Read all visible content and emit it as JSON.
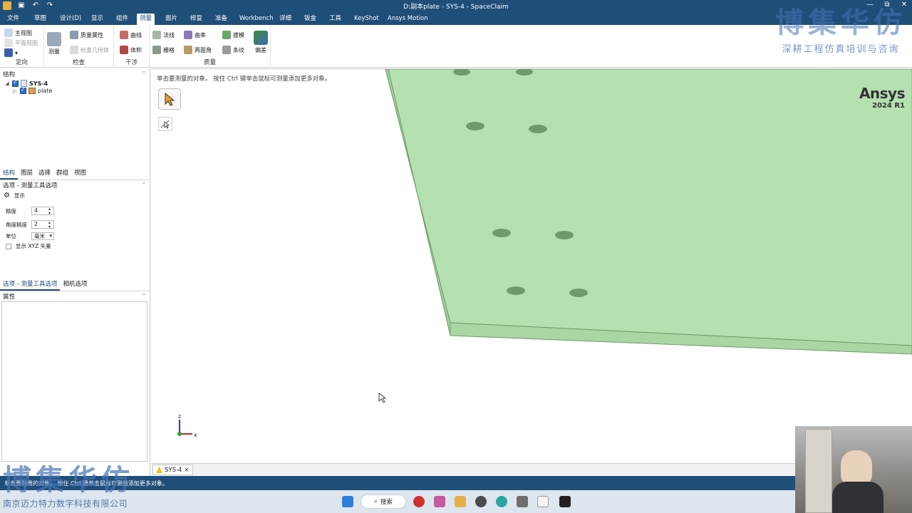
{
  "window": {
    "title": "D:副本plate - SYS-4 - SpaceClaim",
    "minimize": "—",
    "restore": "⧉",
    "close": "✕"
  },
  "menu_tabs": [
    "文件",
    "草图",
    "设计(D)",
    "显示",
    "组件",
    "测量",
    "面片",
    "修复",
    "准备",
    "Workbench",
    "详细",
    "钣金",
    "工具",
    "KeyShot",
    "Ansys Motion"
  ],
  "active_tab": "测量",
  "ribbon": {
    "groups": [
      {
        "label": "定向"
      },
      {
        "label": "检查"
      },
      {
        "label": "干涉"
      },
      {
        "label": "质量"
      }
    ],
    "orient_items": [
      "主视图",
      "平面视图"
    ],
    "measure_big": "测量",
    "inspect_items": [
      "质量属性",
      "检查几何体"
    ],
    "interfere_items": [
      "曲线",
      "体积"
    ],
    "quality_items": [
      "法线",
      "栅格",
      "曲率",
      "两面角",
      "拔模",
      "条纹",
      "偏差"
    ]
  },
  "structure_panel": {
    "title": "结构",
    "tree": [
      {
        "label": "SYS-4",
        "bold": true
      },
      {
        "label": "plate",
        "bold": false
      }
    ]
  },
  "panel_tabs": [
    "结构",
    "图层",
    "选择",
    "群组",
    "视图"
  ],
  "options_panel": {
    "title": "选项 - 测量工具选项",
    "section": "显示",
    "precision_label": "精度",
    "precision_value": "4",
    "angle_precision_label": "角度精度",
    "angle_precision_value": "2",
    "units_label": "单位",
    "units_value": "毫米",
    "show_xyz_label": "显示 XYZ 矢量"
  },
  "options_tabs": [
    "选项 - 测量工具选项",
    "相机选项"
  ],
  "properties_panel": {
    "title": "属性"
  },
  "viewport": {
    "hint": "单击要测量的对象。 按住 Ctrl 键单击鼠标可测量添加更多对象。",
    "brand": "Ansys",
    "version": "2024 R1",
    "axis_z": "z",
    "axis_x": "x",
    "plate_color": "#b5e0b0",
    "hole_color": "#6f9a6a"
  },
  "document_tabs": [
    {
      "label": "SYS-4"
    }
  ],
  "status": {
    "message": "单击要测量的对象。 按住 Ctrl 键单击鼠标可测量添加更多对象。"
  },
  "taskbar": {
    "search_label": "搜索"
  },
  "watermark": {
    "title": "博集华仿",
    "subtitle": "深耕工程仿真培训与咨询",
    "company": "南京迈力特力数字科技有限公司"
  },
  "colors": {
    "titlebar": "#1f4e79",
    "accent": "#2c6fc7"
  }
}
